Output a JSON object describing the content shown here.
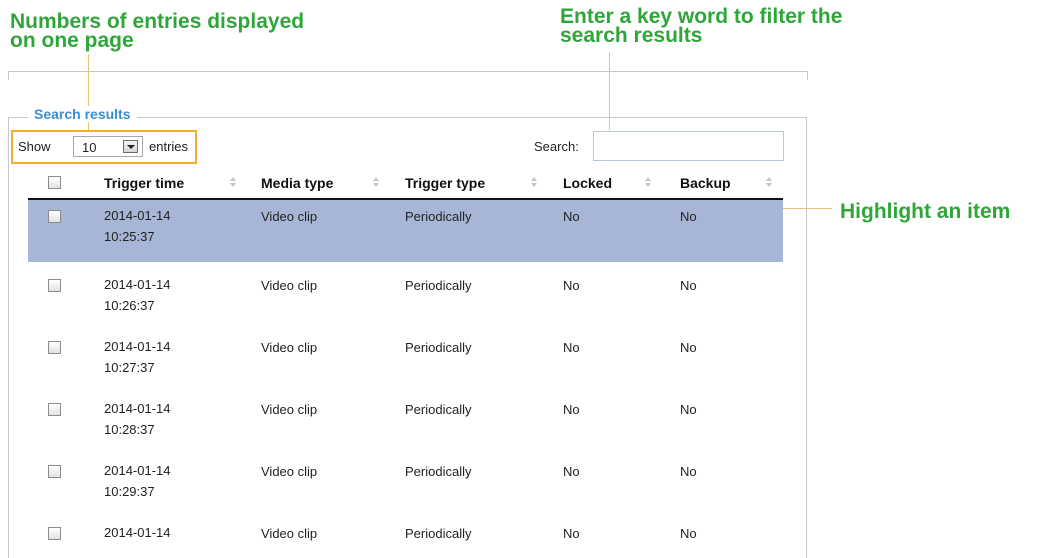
{
  "callouts": {
    "entries_line1": "Numbers of entries displayed",
    "entries_line2": "on one page",
    "search_line1": "Enter a key word to filter the",
    "search_line2": "search results",
    "highlight": "Highlight an item"
  },
  "section_title": "Search results",
  "show_label": "Show",
  "entries_per_page": "10",
  "entries_label": "entries",
  "search": {
    "label": "Search:",
    "value": "",
    "placeholder": ""
  },
  "columns": [
    "Trigger time",
    "Media type",
    "Trigger type",
    "Locked",
    "Backup"
  ],
  "rows": [
    {
      "date": "2014-01-14",
      "time": "10:25:37",
      "media": "Video clip",
      "trigger": "Periodically",
      "locked": "No",
      "backup": "No",
      "highlighted": true
    },
    {
      "date": "2014-01-14",
      "time": "10:26:37",
      "media": "Video clip",
      "trigger": "Periodically",
      "locked": "No",
      "backup": "No",
      "highlighted": false
    },
    {
      "date": "2014-01-14",
      "time": "10:27:37",
      "media": "Video clip",
      "trigger": "Periodically",
      "locked": "No",
      "backup": "No",
      "highlighted": false
    },
    {
      "date": "2014-01-14",
      "time": "10:28:37",
      "media": "Video clip",
      "trigger": "Periodically",
      "locked": "No",
      "backup": "No",
      "highlighted": false
    },
    {
      "date": "2014-01-14",
      "time": "10:29:37",
      "media": "Video clip",
      "trigger": "Periodically",
      "locked": "No",
      "backup": "No",
      "highlighted": false
    },
    {
      "date": "2014-01-14",
      "time": "",
      "media": "Video clip",
      "trigger": "Periodically",
      "locked": "No",
      "backup": "No",
      "highlighted": false
    }
  ],
  "colors": {
    "callout": "#2fa53a",
    "legend": "#3a8ed6",
    "highlight_row": "#a7b6d6",
    "show_box_border": "#f0ad32"
  },
  "icons": {
    "sort": "sort-both-icon",
    "select_dropdown": "chevron-down-icon"
  }
}
